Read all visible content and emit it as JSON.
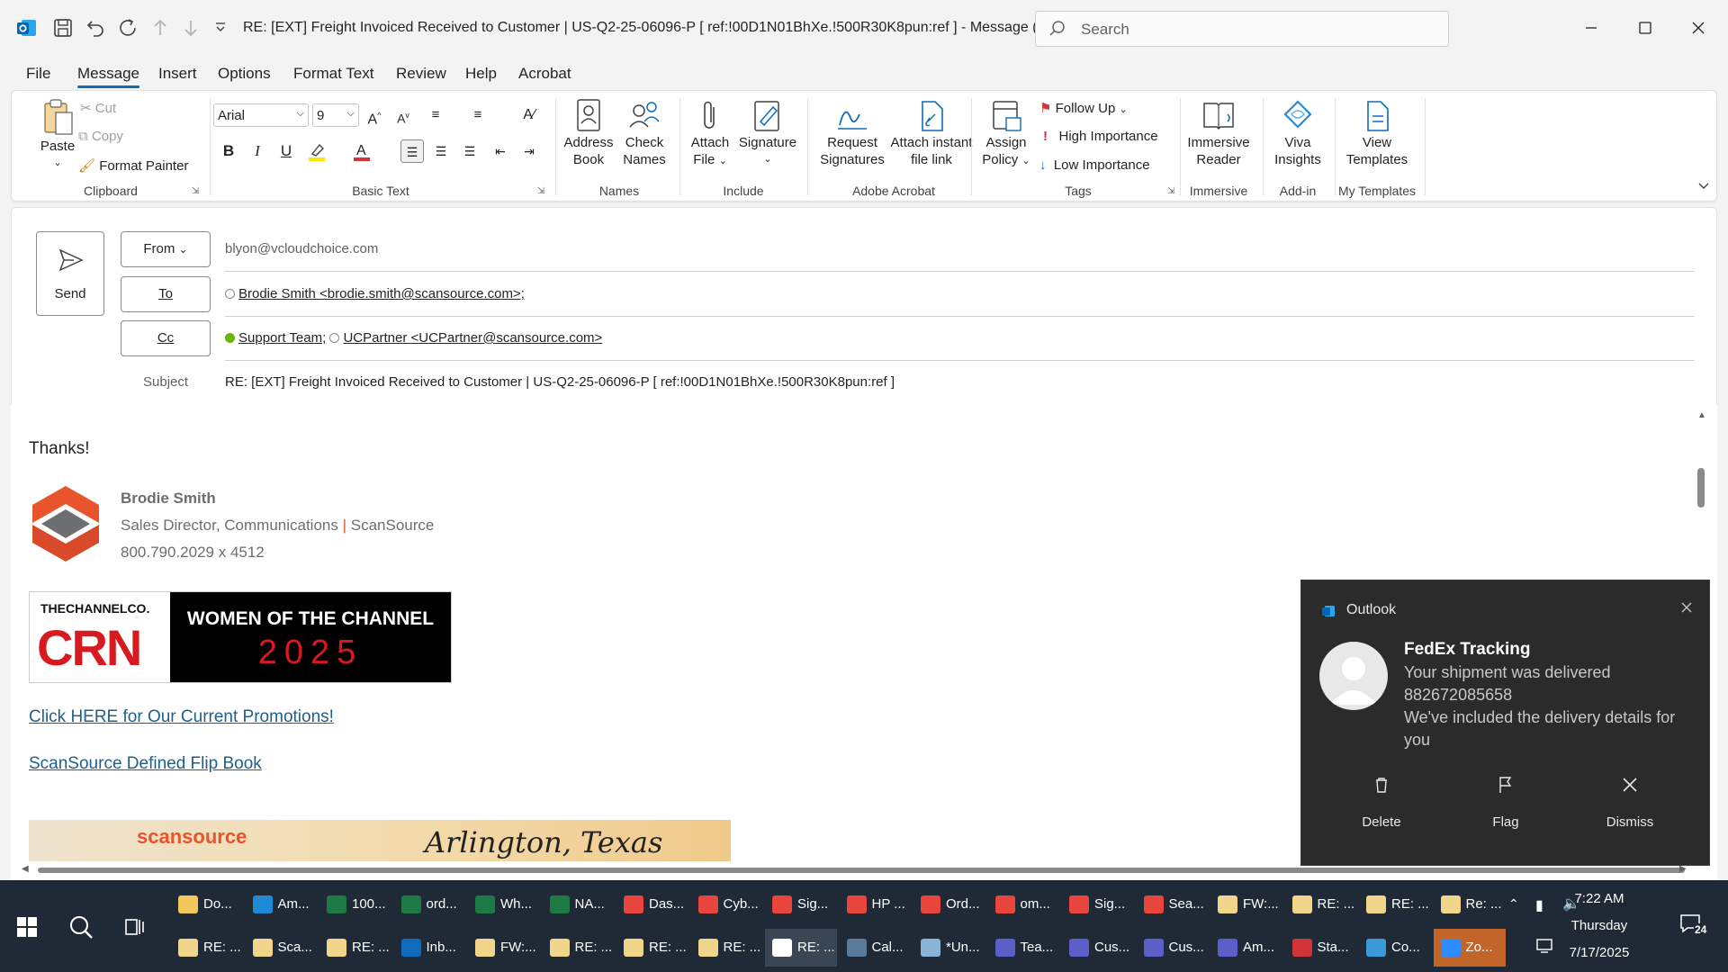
{
  "titlebar": {
    "title": "RE: [EXT] Freight Invoiced Received to Customer | US-Q2-25-06096-P    [ ref:!00D1N01BhXe.!500R30K8pun:ref ]  -  Message (HT...",
    "search_placeholder": "Search"
  },
  "menu": [
    "File",
    "Message",
    "Insert",
    "Options",
    "Format Text",
    "Review",
    "Help",
    "Acrobat"
  ],
  "ribbon": {
    "paste": "Paste",
    "cut": "Cut",
    "copy": "Copy",
    "format_painter": "Format Painter",
    "clipboard": "Clipboard",
    "font_name": "Arial",
    "font_size": "9",
    "basic_text": "Basic Text",
    "address_book": [
      "Address",
      "Book"
    ],
    "check_names": [
      "Check",
      "Names"
    ],
    "names": "Names",
    "attach_file": [
      "Attach",
      "File"
    ],
    "signature": "Signature",
    "include": "Include",
    "request_signatures": [
      "Request",
      "Signatures"
    ],
    "attach_instant": [
      "Attach instant",
      "file link"
    ],
    "adobe_acrobat": "Adobe Acrobat",
    "assign_policy": [
      "Assign",
      "Policy"
    ],
    "follow_up": "Follow Up",
    "high_importance": "High Importance",
    "low_importance": "Low Importance",
    "tags": "Tags",
    "immersive_reader": [
      "Immersive",
      "Reader"
    ],
    "immersive": "Immersive",
    "viva_insights": [
      "Viva",
      "Insights"
    ],
    "add_in": "Add-in",
    "view_templates": [
      "View",
      "Templates"
    ],
    "my_templates": "My Templates"
  },
  "compose": {
    "send": "Send",
    "from_label": "From",
    "from_value": "blyon@vcloudchoice.com",
    "to_label": "To",
    "to_value": "Brodie Smith <brodie.smith@scansource.com>;",
    "cc_label": "Cc",
    "cc_value1": "Support Team;",
    "cc_value2": "UCPartner <UCPartner@scansource.com>",
    "subject_label": "Subject",
    "subject_value": "RE: [EXT] Freight Invoiced Received to Customer | US-Q2-25-06096-P    [ ref:!00D1N01BhXe.!500R30K8pun:ref ]"
  },
  "body": {
    "thanks": "Thanks!",
    "sig_name": "Brodie Smith",
    "sig_title": "Sales Director, Communications",
    "sig_sep": "|",
    "sig_company": "ScanSource",
    "sig_phone": "800.790.2029 x 4512",
    "banner_co": "THECHANNELCO.",
    "banner_crn": "CRN",
    "banner_line1": "WOMEN OF THE CHANNEL",
    "banner_line2": "2025",
    "promo_link": "Click HERE for Our Current Promotions!",
    "flipbook_link": "ScanSource Defined Flip Book",
    "footer_brand": "scansource",
    "footer_city": "Arlington, Texas"
  },
  "toast": {
    "app": "Outlook",
    "title": "FedEx Tracking",
    "line1": "Your shipment was delivered",
    "line2": "882672085658",
    "line3": "We've included the delivery details for",
    "line4": "you",
    "delete": "Delete",
    "flag": "Flag",
    "dismiss": "Dismiss"
  },
  "taskbar": {
    "row1": [
      "Do...",
      "Am...",
      "100...",
      "ord...",
      "Wh...",
      "NA...",
      "Das...",
      "Cyb...",
      "Sig...",
      "HP ...",
      "Ord...",
      "om...",
      "Sig...",
      "Sea...",
      "FW:...",
      "RE: ...",
      "RE: ...",
      "Re: ..."
    ],
    "row2": [
      "RE: ...",
      "Sca...",
      "RE: ...",
      "Inb...",
      "FW:...",
      "RE: ...",
      "RE: ...",
      "RE: ...",
      "RE: ...",
      "Cal...",
      "*Un...",
      "Tea...",
      "Cus...",
      "Cus...",
      "Am...",
      "Sta...",
      "Co...",
      "Zo..."
    ],
    "time": "7:22 AM",
    "day": "Thursday",
    "date": "7/17/2025",
    "notif_count": "24"
  },
  "colors": {
    "accent": "#0f6cbd",
    "crn_red": "#d71920",
    "taskbar": "#1f2a36"
  }
}
